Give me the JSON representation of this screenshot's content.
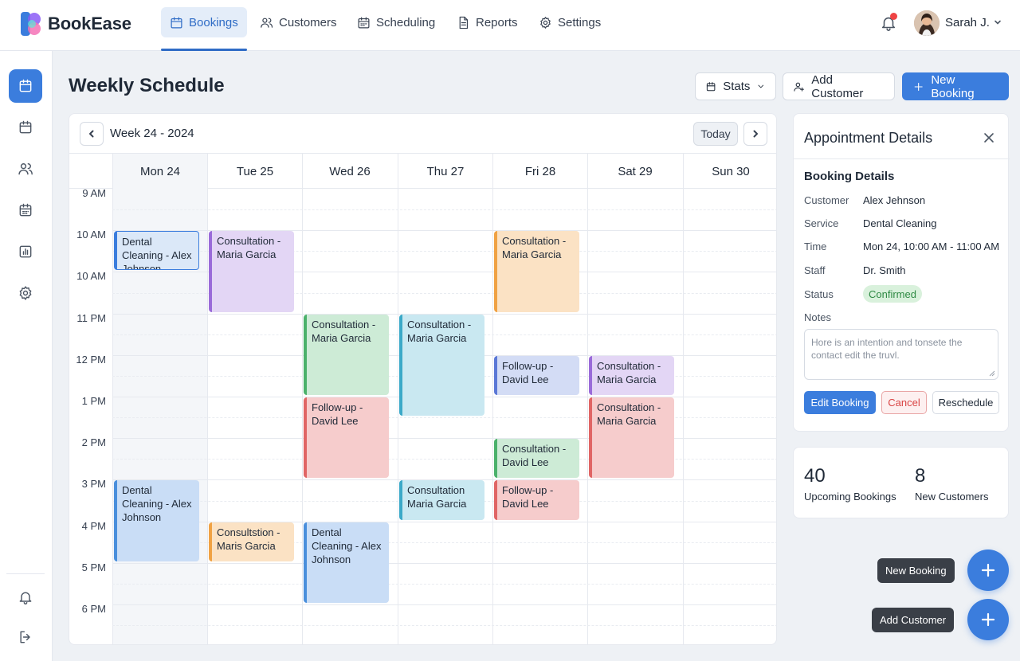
{
  "app": {
    "name": "BookEase",
    "brand_color": "#3b7ddd"
  },
  "nav": {
    "bookings": "Bookings",
    "customers": "Customers",
    "scheduling": "Scheduling",
    "reports": "Reports",
    "settings": "Settings"
  },
  "user": {
    "name": "Sarah J."
  },
  "page": {
    "title": "Weekly Schedule"
  },
  "header_buttons": {
    "stats": "Stats",
    "add_customer": "Add Customer",
    "new_booking": "New Booking"
  },
  "calendar": {
    "week_label": "Week 24 - 2024",
    "today": "Today",
    "days": [
      "Mon 24",
      "Tue 25",
      "Wed 26",
      "Thu 27",
      "Fri 28",
      "Sat 29",
      "Sun 30"
    ],
    "times": [
      "9 AM",
      "10 AM",
      "10 AM",
      "11 PM",
      "12 PM",
      "1 PM",
      "2 PM",
      "3 PM",
      "4 PM",
      "5 PM",
      "6 PM"
    ],
    "events": [
      {
        "title": "Dental Cleaning - Alex Johnson",
        "day": "Mon 24",
        "start": "10 AM",
        "slots": 1,
        "color": "blue",
        "selected": true
      },
      {
        "title": "Dental Cleaning - Alex Johnson",
        "day": "Mon 24",
        "start": "3 PM",
        "slots": 2,
        "color": "blue"
      },
      {
        "title": "Consultation - Maria Garcia",
        "day": "Tue 25",
        "start": "10 AM",
        "slots": 2,
        "color": "purple"
      },
      {
        "title": "Consultstion - Maris Garcia",
        "day": "Tue 25",
        "start": "4 PM",
        "slots": 1,
        "color": "orange"
      },
      {
        "title": "Consultation - Maria Garcia",
        "day": "Wed 26",
        "start": "11 PM",
        "slots": 2,
        "color": "green"
      },
      {
        "title": "Follow-up - David Lee",
        "day": "Wed 26",
        "start": "1 PM",
        "slots": 2,
        "color": "red"
      },
      {
        "title": "Dental Cleaning - Alex Johnson",
        "day": "Wed 26",
        "start": "4 PM",
        "slots": 2,
        "color": "blue"
      },
      {
        "title": "Consultation - Maria Garcia",
        "day": "Thu 27",
        "start": "11 PM",
        "slots": 2.5,
        "color": "cyan"
      },
      {
        "title": "Consultation Maria Garcia",
        "day": "Thu 27",
        "start": "3 PM",
        "slots": 1,
        "color": "cyan"
      },
      {
        "title": "Consultation - Maria Garcia",
        "day": "Fri 28",
        "start": "10 AM",
        "slots": 2,
        "color": "orange"
      },
      {
        "title": "Follow-up - David Lee",
        "day": "Fri 28",
        "start": "12 PM",
        "slots": 1,
        "color": "indigo"
      },
      {
        "title": "Consultation - David Lee",
        "day": "Fri 28",
        "start": "2 PM",
        "slots": 1,
        "color": "green"
      },
      {
        "title": "Follow-up - David Lee",
        "day": "Fri 28",
        "start": "3 PM",
        "slots": 1,
        "color": "red"
      },
      {
        "title": "Consultation - Maria Garcia",
        "day": "Sat 29",
        "start": "12 PM",
        "slots": 1,
        "color": "purple"
      },
      {
        "title": "Consultation - Maria Garcia",
        "day": "Sat 29",
        "start": "1 PM",
        "slots": 2,
        "color": "red"
      }
    ]
  },
  "details": {
    "title": "Appointment Details",
    "section": "Booking Details",
    "customer_label": "Customer",
    "customer": "Alex Jehnson",
    "service_label": "Service",
    "service": "Dental Cleaning",
    "time_label": "Time",
    "time": "Mon 24, 10:00 AM - 11:00 AM",
    "staff_label": "Staff",
    "staff": "Dr. Smith",
    "status_label": "Status",
    "status": "Confirmed",
    "notes_label": "Notes",
    "notes": "Hore is an intention and tonsete the contact edit the truvl.",
    "edit": "Edit Booking",
    "cancel": "Cancel",
    "reschedule": "Reschedule"
  },
  "stats": {
    "upcoming": "40",
    "upcoming_label": "Upcoming Bookings",
    "new_customers": "8",
    "new_customers_label": "New Customers"
  },
  "fab": {
    "new_booking": "New Booking",
    "add_customer": "Add Customer"
  }
}
